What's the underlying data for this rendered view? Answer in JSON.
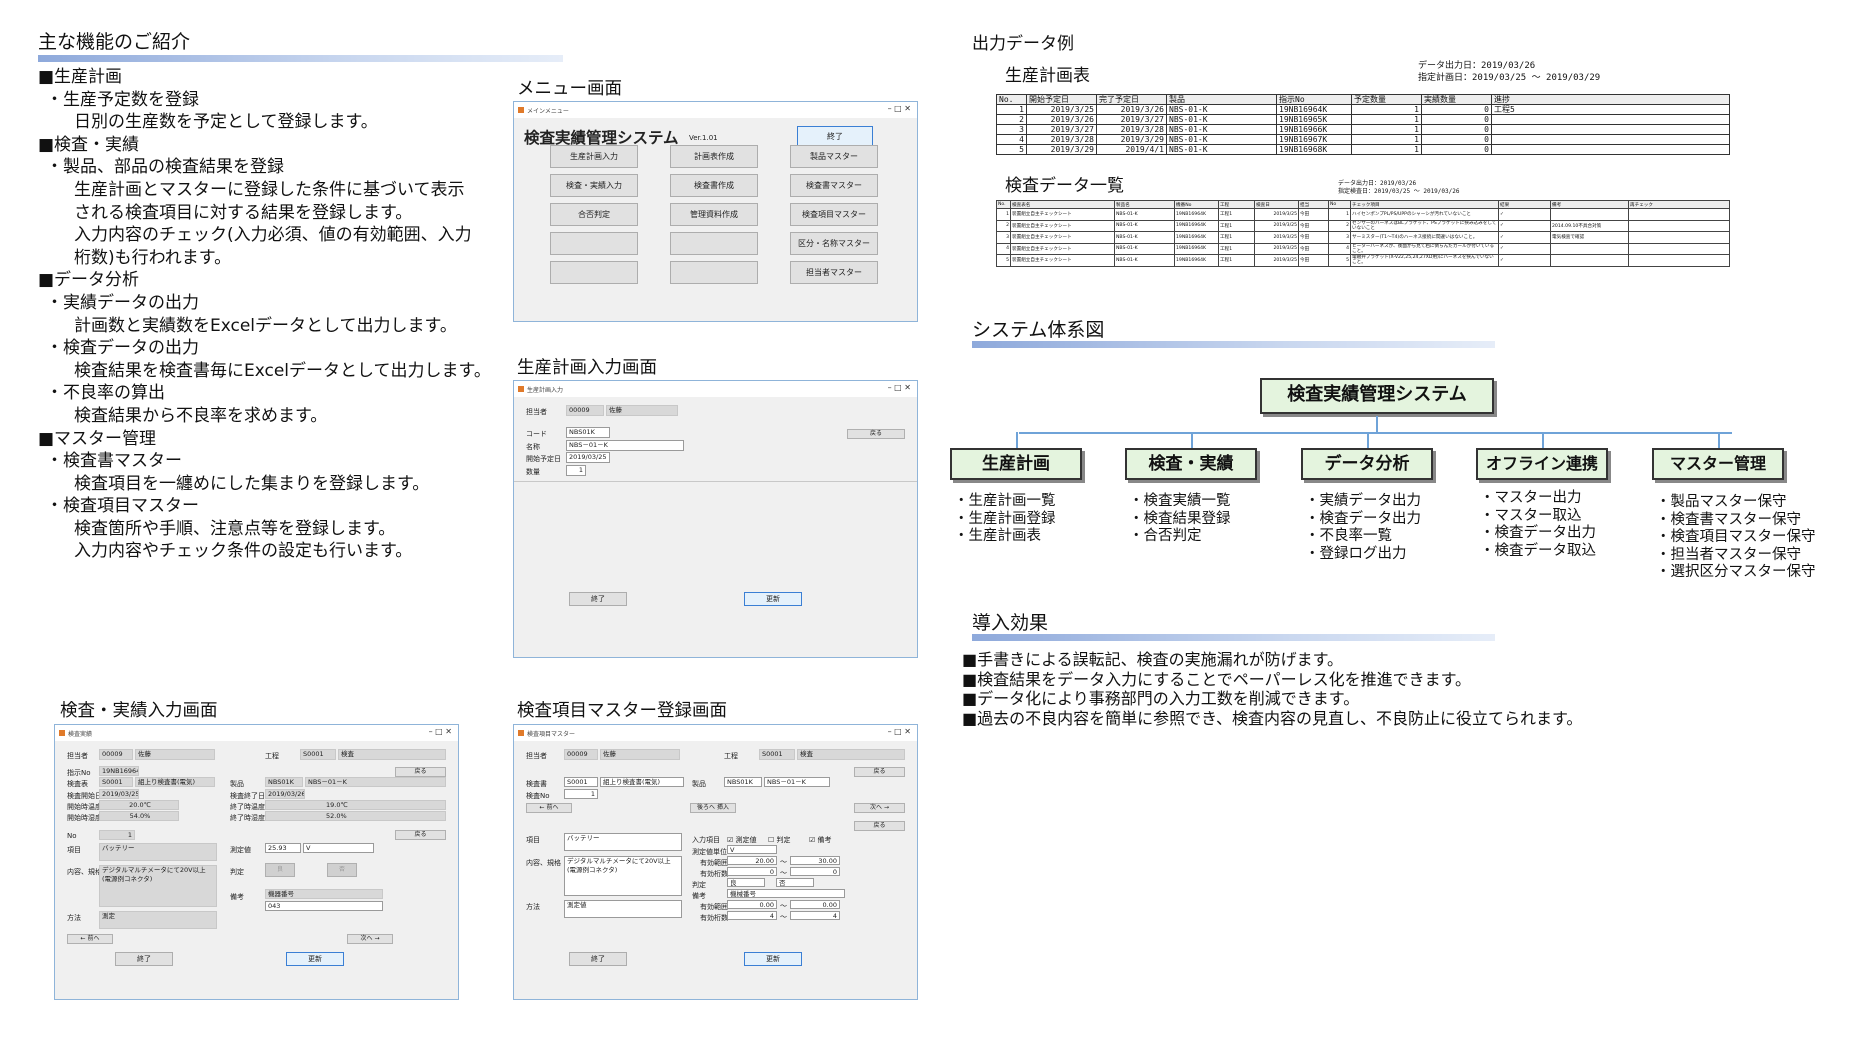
{
  "features": {
    "title": "主な機能のご紹介",
    "lines": [
      {
        "lv": 0,
        "text": "■生産計画"
      },
      {
        "lv": 1,
        "text": "・生産予定数を登録"
      },
      {
        "lv": 2,
        "text": "日別の生産数を予定として登録します。"
      },
      {
        "lv": 0,
        "text": "■検査・実績"
      },
      {
        "lv": 1,
        "text": "・製品、部品の検査結果を登録"
      },
      {
        "lv": 2,
        "text": "生産計画とマスターに登録した条件に基づいて表示"
      },
      {
        "lv": 2,
        "text": "される検査項目に対する結果を登録します。"
      },
      {
        "lv": 2,
        "text": "入力内容のチェック(入力必須、値の有効範囲、入力"
      },
      {
        "lv": 2,
        "text": "桁数)も行われます。"
      },
      {
        "lv": 0,
        "text": "■データ分析"
      },
      {
        "lv": 1,
        "text": "・実績データの出力"
      },
      {
        "lv": 2,
        "text": "計画数と実績数をExcelデータとして出力します。"
      },
      {
        "lv": 1,
        "text": "・検査データの出力"
      },
      {
        "lv": 2,
        "text": "検査結果を検査書毎にExcelデータとして出力します。"
      },
      {
        "lv": 1,
        "text": "・不良率の算出"
      },
      {
        "lv": 2,
        "text": "検査結果から不良率を求めます。"
      },
      {
        "lv": 0,
        "text": "■マスター管理"
      },
      {
        "lv": 1,
        "text": "・検査書マスター"
      },
      {
        "lv": 2,
        "text": "検査項目を一纏めにした集まりを登録します。"
      },
      {
        "lv": 1,
        "text": "・検査項目マスター"
      },
      {
        "lv": 2,
        "text": "検査箇所や手順、注意点等を登録します。"
      },
      {
        "lv": 2,
        "text": "入力内容やチェック条件の設定も行います。"
      }
    ]
  },
  "menu_screen": {
    "caption": "メニュー画面",
    "window_title": "メインメニュー",
    "app_title": "検査実績管理システム",
    "version": "Ver.1.01",
    "exit": "終了",
    "buttons": [
      "生産計画入力",
      "計画表作成",
      "製品マスター",
      "検査・実績入力",
      "検査書作成",
      "検査書マスター",
      "合否判定",
      "管理資料作成",
      "検査項目マスター",
      "",
      "",
      "区分・名称マスター",
      "",
      "",
      "担当者マスター"
    ]
  },
  "plan_screen": {
    "caption": "生産計画入力画面",
    "window_title": "生産計画入力",
    "person_label": "担当者",
    "person_code": "00009",
    "person_name": "佐藤",
    "code_label": "コード",
    "code_value": "NBS01K",
    "name_label": "名称",
    "name_value": "NBS－01－K",
    "date_label": "開始予定日",
    "date_value": "2019/03/25",
    "qty_label": "数量",
    "qty_value": "1",
    "back": "戻る",
    "end": "終了",
    "update": "更新"
  },
  "inspect_screen": {
    "caption": "検査・実績入力画面",
    "window_title": "検査実績",
    "person_label": "担当者",
    "person_code": "00009",
    "person_name": "佐藤",
    "process_label": "工程",
    "process_code": "S0001",
    "process_name": "検査",
    "order_label": "指示No",
    "order_value": "19NB16964K",
    "sheet_label": "検査表",
    "sheet_code": "S0001",
    "sheet_name": "組上り検査書(電気)",
    "product_label": "製品",
    "product_code": "NBS01K",
    "product_name": "NBS－01－K",
    "start_label": "検査開始日",
    "start_value": "2019/03/25",
    "end_label": "検査終了日",
    "end_value": "2019/03/26",
    "t1_label": "開始時温度",
    "t1_value": "20.0℃",
    "t2_label": "終了時温度",
    "t2_value": "19.0℃",
    "h1_label": "開始時湿度",
    "h1_value": "54.0%",
    "h2_label": "終了時湿度",
    "h2_value": "52.0%",
    "no_label": "No",
    "no_value": "1",
    "item_label": "項目",
    "item_value": "バッテリー",
    "meas_label": "測定値",
    "meas_value": "25.93",
    "meas_unit": "V",
    "content_label": "内容、規格",
    "content_value": "デジタルマルチメータにて20V以上\n(電源例コネクタ)",
    "judge_label": "判定",
    "judge_ok": "良",
    "judge_ng": "否",
    "method_label": "方法",
    "method_value": "測定",
    "note_label": "備考",
    "note_value": "機器番号",
    "note_value2": "043",
    "back": "戻る",
    "prev": "← 前へ",
    "next": "次へ →",
    "end": "終了",
    "update": "更新"
  },
  "master_screen": {
    "caption": "検査項目マスター登録画面",
    "window_title": "検査項目マスター",
    "person_label": "担当者",
    "person_code": "00009",
    "person_name": "佐藤",
    "process_label": "工程",
    "process_code": "S0001",
    "process_name": "検査",
    "sheet_label": "検査書",
    "sheet_code": "S0001",
    "sheet_name": "組上り検査書(電気)",
    "product_label": "製品",
    "product_code": "NBS01K",
    "product_name": "NBS－01－K",
    "no_label": "検査No",
    "no_value": "1",
    "back": "戻る",
    "prev": "← 前へ",
    "insert": "後ろへ 挿入",
    "next": "次へ →",
    "item_label": "項目",
    "item_value": "バッテリー",
    "input_label": "入力項目",
    "chk1": "☑ 測定値",
    "chk2": "☐ 判定",
    "chk3": "☑ 備考",
    "unit_label": "測定値単位",
    "unit_value": "V",
    "range_label": "有効範囲",
    "range_from": "20.00",
    "range_to": "30.00",
    "digits_label": "有効桁数",
    "digits_from": "0",
    "digits_to": "0",
    "judge_label": "判定",
    "judge_ok": "良",
    "judge_ng": "否",
    "note_label": "備考",
    "note_value": "機械番号",
    "range2_label": "有効範囲",
    "range2_from": "0.00",
    "range2_to": "0.00",
    "digits2_label": "有効桁数",
    "digits2_from": "4",
    "digits2_to": "4",
    "content_label": "内容、規格",
    "content_value": "デジタルマルチメータにて20V以上\n(電源例コネクタ)",
    "method_label": "方法",
    "method_value": "測定値",
    "tilde": "～",
    "end": "終了",
    "update": "更新"
  },
  "output": {
    "caption": "出力データ例",
    "plan_title": "生産計画表",
    "plan_meta1": "データ出力日：2019/03/26",
    "plan_meta2": "指定計画日：2019/03/25 ～ 2019/03/29",
    "plan_headers": [
      "No.",
      "開始予定日",
      "完了予定日",
      "製品",
      "指示No",
      "予定数量",
      "実績数量",
      "進捗"
    ],
    "plan_rows": [
      [
        "1",
        "2019/3/25",
        "2019/3/26",
        "NBS-01-K",
        "19NB16964K",
        "1",
        "0",
        "工程5"
      ],
      [
        "2",
        "2019/3/26",
        "2019/3/27",
        "NBS-01-K",
        "19NB16965K",
        "1",
        "0",
        ""
      ],
      [
        "3",
        "2019/3/27",
        "2019/3/28",
        "NBS-01-K",
        "19NB16966K",
        "1",
        "0",
        ""
      ],
      [
        "4",
        "2019/3/28",
        "2019/3/29",
        "NBS-01-K",
        "19NB16967K",
        "1",
        "0",
        ""
      ],
      [
        "5",
        "2019/3/29",
        "2019/4/1",
        "NBS-01-K",
        "19NB16968K",
        "1",
        "0",
        ""
      ]
    ],
    "insp_title": "検査データ一覧",
    "insp_meta1": "データ出力日：2019/03/26",
    "insp_meta2": "指定検査日：2019/03/25 ～ 2019/03/26",
    "insp_headers": [
      "No.",
      "検査表名",
      "製品名",
      "機番No",
      "工程",
      "検査日",
      "担当",
      "No",
      "チェック項目",
      "結果",
      "備考",
      "再チェック"
    ],
    "insp_rows": [
      [
        "1",
        "装置組立自主チェックシート",
        "NBS-01-K",
        "19NB16964K",
        "工程1",
        "2019/3/25",
        "今田",
        "1",
        "ハイセンポンプPL/PS/UPPのシャーシが汚れていないこと",
        "✓",
        "",
        ""
      ],
      [
        "2",
        "装置組立自主チェックシート",
        "NBS-01-K",
        "19NB16964K",
        "工程1",
        "2019/3/25",
        "今田",
        "2",
        "センサーのハーネスはBLブラケット、PSブラケットに挟み込みをしていないこと",
        "✓",
        "2014.09.10不具合対策",
        ""
      ],
      [
        "3",
        "装置組立自主チェックシート",
        "NBS-01-K",
        "19NB16964K",
        "工程1",
        "2019/3/25",
        "今田",
        "3",
        "サーミスター(T1～T4)のハーネス接続に間違いはないこと。",
        "✓",
        "電気検査で確認",
        ""
      ],
      [
        "4",
        "装置組立自主チェックシート",
        "NBS-01-K",
        "19NB16964K",
        "工程1",
        "2019/3/25",
        "今田",
        "4",
        "ヒーターハーネスが、後面から見て右に倒らんだカールが付いていること。",
        "✓",
        "",
        ""
      ],
      [
        "5",
        "装置組立自主チェックシート",
        "NBS-01-K",
        "19NB16964K",
        "工程1",
        "2019/3/25",
        "今田",
        "5",
        "電磁弁ブラケット(X-V22,25,24,27XD用)にハーネスを挟んでいないこと。",
        "✓",
        "",
        ""
      ]
    ]
  },
  "system": {
    "title": "システム体系図",
    "root": "検査実績管理システム",
    "groups": [
      {
        "name": "生産計画",
        "items": [
          "・生産計画一覧",
          "・生産計画登録",
          "・生産計画表"
        ]
      },
      {
        "name": "検査・実績",
        "items": [
          "・検査実績一覧",
          "・検査結果登録",
          "・合否判定"
        ]
      },
      {
        "name": "データ分析",
        "items": [
          "・実績データ出力",
          "・検査データ出力",
          "・不良率一覧",
          "・登録ログ出力"
        ]
      },
      {
        "name": "オフライン連携",
        "items": [
          "・マスター出力",
          "・マスター取込",
          "・検査データ出力",
          "・検査データ取込"
        ]
      },
      {
        "name": "マスター管理",
        "items": [
          "・製品マスター保守",
          "・検査書マスター保守",
          "・検査項目マスター保守",
          "・担当者マスター保守",
          "・選択区分マスター保守"
        ]
      }
    ]
  },
  "effects": {
    "title": "導入効果",
    "lines": [
      "■手書きによる誤転記、検査の実施漏れが防げます。",
      "■検査結果をデータ入力にすることでペーパーレス化を推進できます。",
      "■データ化により事務部門の入力工数を削減できます。",
      "■過去の不良内容を簡単に参照でき、検査内容の見直し、不良防止に役立てられます。"
    ]
  }
}
